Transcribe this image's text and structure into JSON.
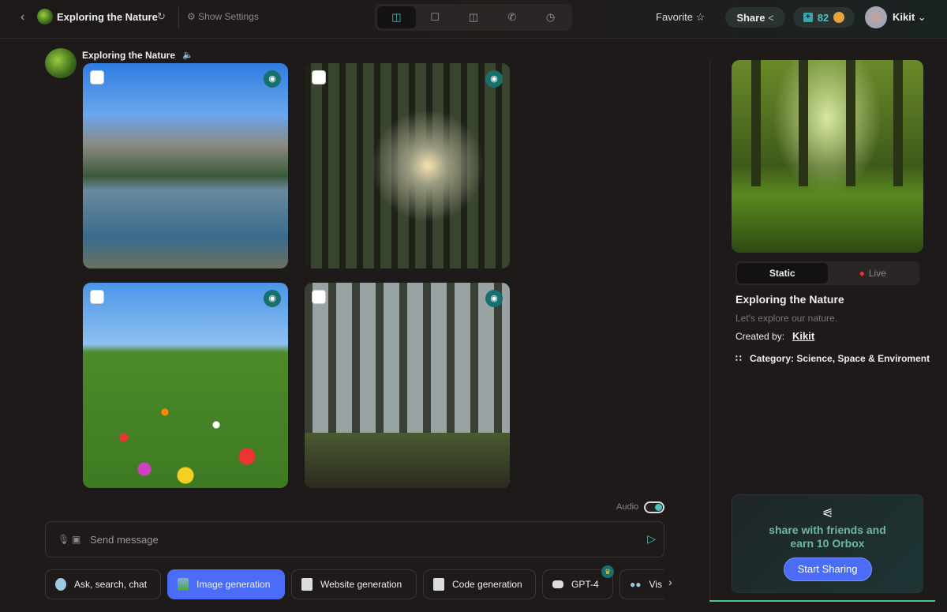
{
  "header": {
    "title": "Exploring the Nature",
    "settings_label": "Show Settings",
    "favorite_label": "Favorite",
    "share_label": "Share",
    "credits": "82",
    "username": "Kikit",
    "toolbar_icons": [
      "split-view-icon",
      "chat-icon",
      "sidebar-icon",
      "phone-icon",
      "history-icon"
    ]
  },
  "chat": {
    "bot_name": "Exploring the Nature",
    "images": [
      {
        "name": "mountain-lake",
        "colors": [
          "#2f7de0",
          "#8a8a80",
          "#3a6b8c"
        ]
      },
      {
        "name": "sunlit-forest",
        "colors": [
          "#c9c9b8",
          "#2d3a22",
          "#4f6a2a"
        ]
      },
      {
        "name": "wildflower-meadow",
        "colors": [
          "#4a96e8",
          "#4c8a2a",
          "#3e7a22"
        ]
      },
      {
        "name": "misty-forest",
        "colors": [
          "#b9c2c2",
          "#4d5a54",
          "#3b4a2a"
        ]
      }
    ]
  },
  "composer": {
    "audio_label": "Audio",
    "audio_on": true,
    "placeholder": "Send message",
    "chips": [
      {
        "label": "Ask, search, chat",
        "active": false
      },
      {
        "label": "Image generation",
        "active": true
      },
      {
        "label": "Website generation",
        "active": false
      },
      {
        "label": "Code generation",
        "active": false
      },
      {
        "label": "GPT-4",
        "active": false
      },
      {
        "label": "Vis",
        "active": false
      }
    ]
  },
  "panel": {
    "tab_static": "Static",
    "tab_live": "Live",
    "title": "Exploring the Nature",
    "description": "Let's explore our nature.",
    "created_by_label": "Created by:",
    "creator": "Kikit",
    "category": "Category: Science, Space & Enviroment",
    "share_card": {
      "text_line1": "share with friends and",
      "text_line2": "earn 10 Orbox",
      "button": "Start Sharing"
    },
    "accent": "#4fc1c1",
    "button_color": "#4a6cf7"
  }
}
